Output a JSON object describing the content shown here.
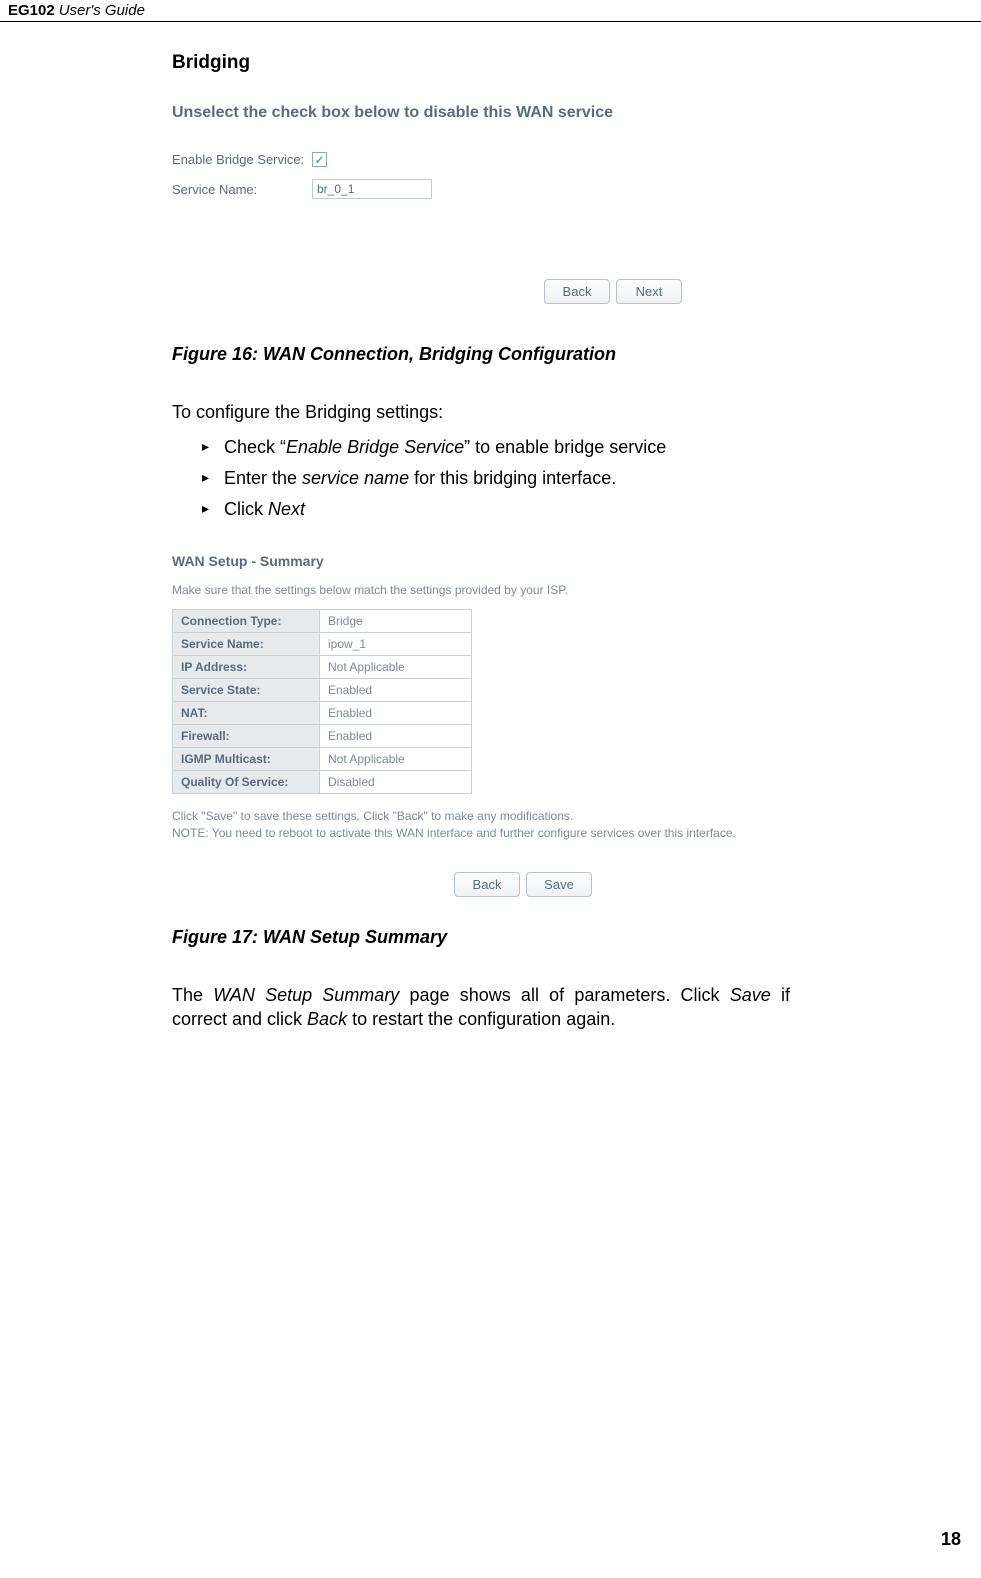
{
  "header": {
    "bold": "EG102",
    "italic": "User's Guide"
  },
  "section_title": "Bridging",
  "shot1": {
    "title": "Unselect the check box below to disable this WAN service",
    "enable_label": "Enable Bridge Service:",
    "service_label": "Service Name:",
    "service_value": "br_0_1",
    "checkmark": "✓",
    "back": "Back",
    "next": "Next"
  },
  "fig16_caption": "Figure 16: WAN Connection, Bridging Configuration",
  "intro": "To configure the Bridging settings:",
  "bullets": {
    "b1a": "Check “",
    "b1i": "Enable Bridge Service",
    "b1b": "” to enable bridge service",
    "b2a": "Enter the ",
    "b2i": "service name",
    "b2b": " for this bridging interface.",
    "b3a": "Click ",
    "b3i": "Next"
  },
  "shot2": {
    "title": "WAN Setup - Summary",
    "sub": "Make sure that the settings below match the settings provided by your ISP.",
    "rows": [
      {
        "k": "Connection Type:",
        "v": "Bridge"
      },
      {
        "k": "Service Name:",
        "v": "ipow_1"
      },
      {
        "k": "IP Address:",
        "v": "Not Applicable"
      },
      {
        "k": "Service State:",
        "v": "Enabled"
      },
      {
        "k": "NAT:",
        "v": "Enabled"
      },
      {
        "k": "Firewall:",
        "v": "Enabled"
      },
      {
        "k": "IGMP Multicast:",
        "v": "Not Applicable"
      },
      {
        "k": "Quality Of Service:",
        "v": "Disabled"
      }
    ],
    "note1": "Click \"Save\" to save these settings. Click \"Back\" to make any modifications.",
    "note2": "NOTE: You need to reboot to activate this WAN interface and further configure services over this interface.",
    "back": "Back",
    "save": "Save"
  },
  "fig17_caption": "Figure 17: WAN Setup Summary",
  "summary_body_a": "The ",
  "summary_body_i1": "WAN Setup Summary",
  "summary_body_b": " page shows all of parameters. Click ",
  "summary_body_i2": "Save",
  "summary_body_c": " if correct and click ",
  "summary_body_i3": "Back",
  "summary_body_d": " to restart the configuration again.",
  "page_num": "18"
}
